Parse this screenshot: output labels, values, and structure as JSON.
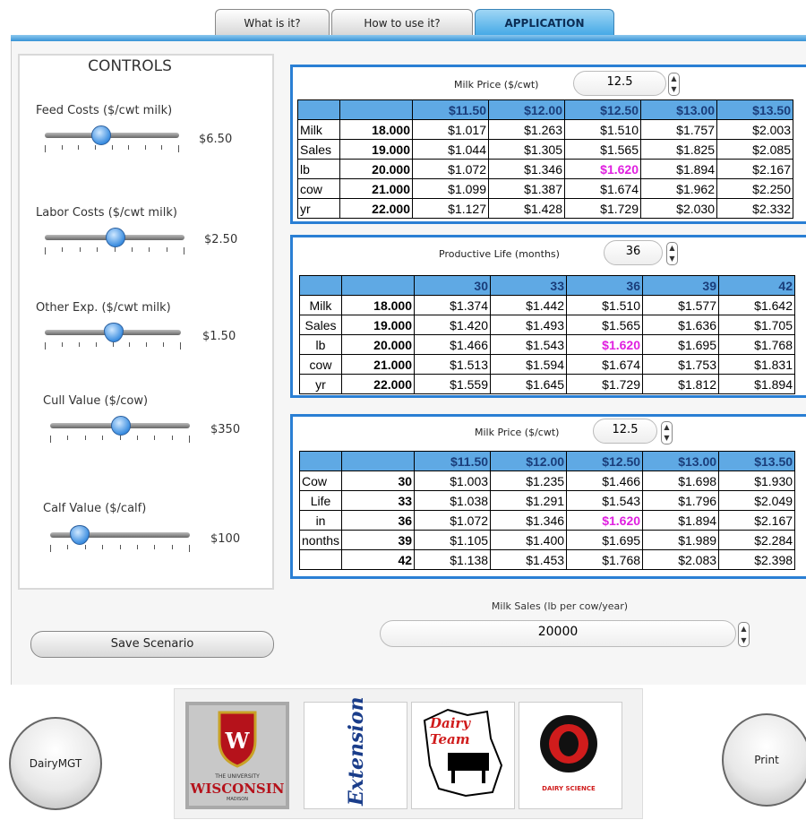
{
  "tabs": [
    {
      "label": "What is it?"
    },
    {
      "label": "How to use it?"
    },
    {
      "label": "APPLICATION"
    }
  ],
  "colors": {
    "accent": "#2a7fd4",
    "header_fill": "#5fa9e4",
    "highlight": "#e020e0"
  },
  "controls": {
    "title": "CONTROLS",
    "sliders": [
      {
        "label": "Feed Costs ($/cwt milk)",
        "value": "$6.50"
      },
      {
        "label": "Labor Costs ($/cwt milk)",
        "value": "$2.50"
      },
      {
        "label": "Other Exp. ($/cwt milk)",
        "value": "$1.50"
      },
      {
        "label": "Cull Value ($/cow)",
        "value": "$350"
      },
      {
        "label": "Calf Value ($/calf)",
        "value": "$100"
      }
    ],
    "save_label": "Save Scenario"
  },
  "tables": [
    {
      "title": "Milk Price ($/cwt)",
      "input_value": "12.5",
      "columns": [
        "$11.50",
        "$12.00",
        "$12.50",
        "$13.00",
        "$13.50"
      ],
      "side_labels": [
        "Milk",
        "Sales",
        "lb",
        "cow",
        "yr"
      ],
      "rows": [
        {
          "key": "18.000",
          "values": [
            "$1.017",
            "$1.263",
            "$1.510",
            "$1.757",
            "$2.003"
          ]
        },
        {
          "key": "19.000",
          "values": [
            "$1.044",
            "$1.305",
            "$1.565",
            "$1.825",
            "$2.085"
          ]
        },
        {
          "key": "20.000",
          "values": [
            "$1.072",
            "$1.346",
            "$1.620",
            "$1.894",
            "$2.167"
          ]
        },
        {
          "key": "21.000",
          "values": [
            "$1.099",
            "$1.387",
            "$1.674",
            "$1.962",
            "$2.250"
          ]
        },
        {
          "key": "22.000",
          "values": [
            "$1.127",
            "$1.428",
            "$1.729",
            "$2.030",
            "$2.332"
          ]
        }
      ]
    },
    {
      "title": "Productive Life (months)",
      "input_value": "36",
      "columns": [
        "30",
        "33",
        "36",
        "39",
        "42"
      ],
      "side_labels": [
        "Milk",
        "Sales",
        "lb",
        "cow",
        "yr"
      ],
      "rows": [
        {
          "key": "18.000",
          "values": [
            "$1.374",
            "$1.442",
            "$1.510",
            "$1.577",
            "$1.642"
          ]
        },
        {
          "key": "19.000",
          "values": [
            "$1.420",
            "$1.493",
            "$1.565",
            "$1.636",
            "$1.705"
          ]
        },
        {
          "key": "20.000",
          "values": [
            "$1.466",
            "$1.543",
            "$1.620",
            "$1.695",
            "$1.768"
          ]
        },
        {
          "key": "21.000",
          "values": [
            "$1.513",
            "$1.594",
            "$1.674",
            "$1.753",
            "$1.831"
          ]
        },
        {
          "key": "22.000",
          "values": [
            "$1.559",
            "$1.645",
            "$1.729",
            "$1.812",
            "$1.894"
          ]
        }
      ]
    },
    {
      "title": "Milk Price ($/cwt)",
      "input_value": "12.5",
      "columns": [
        "$11.50",
        "$12.00",
        "$12.50",
        "$13.00",
        "$13.50"
      ],
      "side_labels": [
        "Cow",
        "Life",
        "in",
        "nonths",
        ""
      ],
      "rows": [
        {
          "key": "30",
          "values": [
            "$1.003",
            "$1.235",
            "$1.466",
            "$1.698",
            "$1.930"
          ]
        },
        {
          "key": "33",
          "values": [
            "$1.038",
            "$1.291",
            "$1.543",
            "$1.796",
            "$2.049"
          ]
        },
        {
          "key": "36",
          "values": [
            "$1.072",
            "$1.346",
            "$1.620",
            "$1.894",
            "$2.167"
          ]
        },
        {
          "key": "39",
          "values": [
            "$1.105",
            "$1.400",
            "$1.695",
            "$1.989",
            "$2.284"
          ]
        },
        {
          "key": "42",
          "values": [
            "$1.138",
            "$1.453",
            "$1.768",
            "$2.083",
            "$2.398"
          ]
        }
      ]
    }
  ],
  "milk_sales": {
    "label": "Milk Sales (lb per cow/year)",
    "value": "20000"
  },
  "buttons": {
    "dairymgt": "DairyMGT",
    "print": "Print"
  },
  "logos": [
    {
      "name": "wisconsin",
      "text_top": "THE UNIVERSITY",
      "text_main": "WISCONSIN",
      "text_bottom": "MADISON"
    },
    {
      "name": "extension",
      "text": "Extension"
    },
    {
      "name": "dairy-team",
      "text": "Dairy Team"
    },
    {
      "name": "dairy-science",
      "text": "DAIRY SCIENCE"
    }
  ]
}
